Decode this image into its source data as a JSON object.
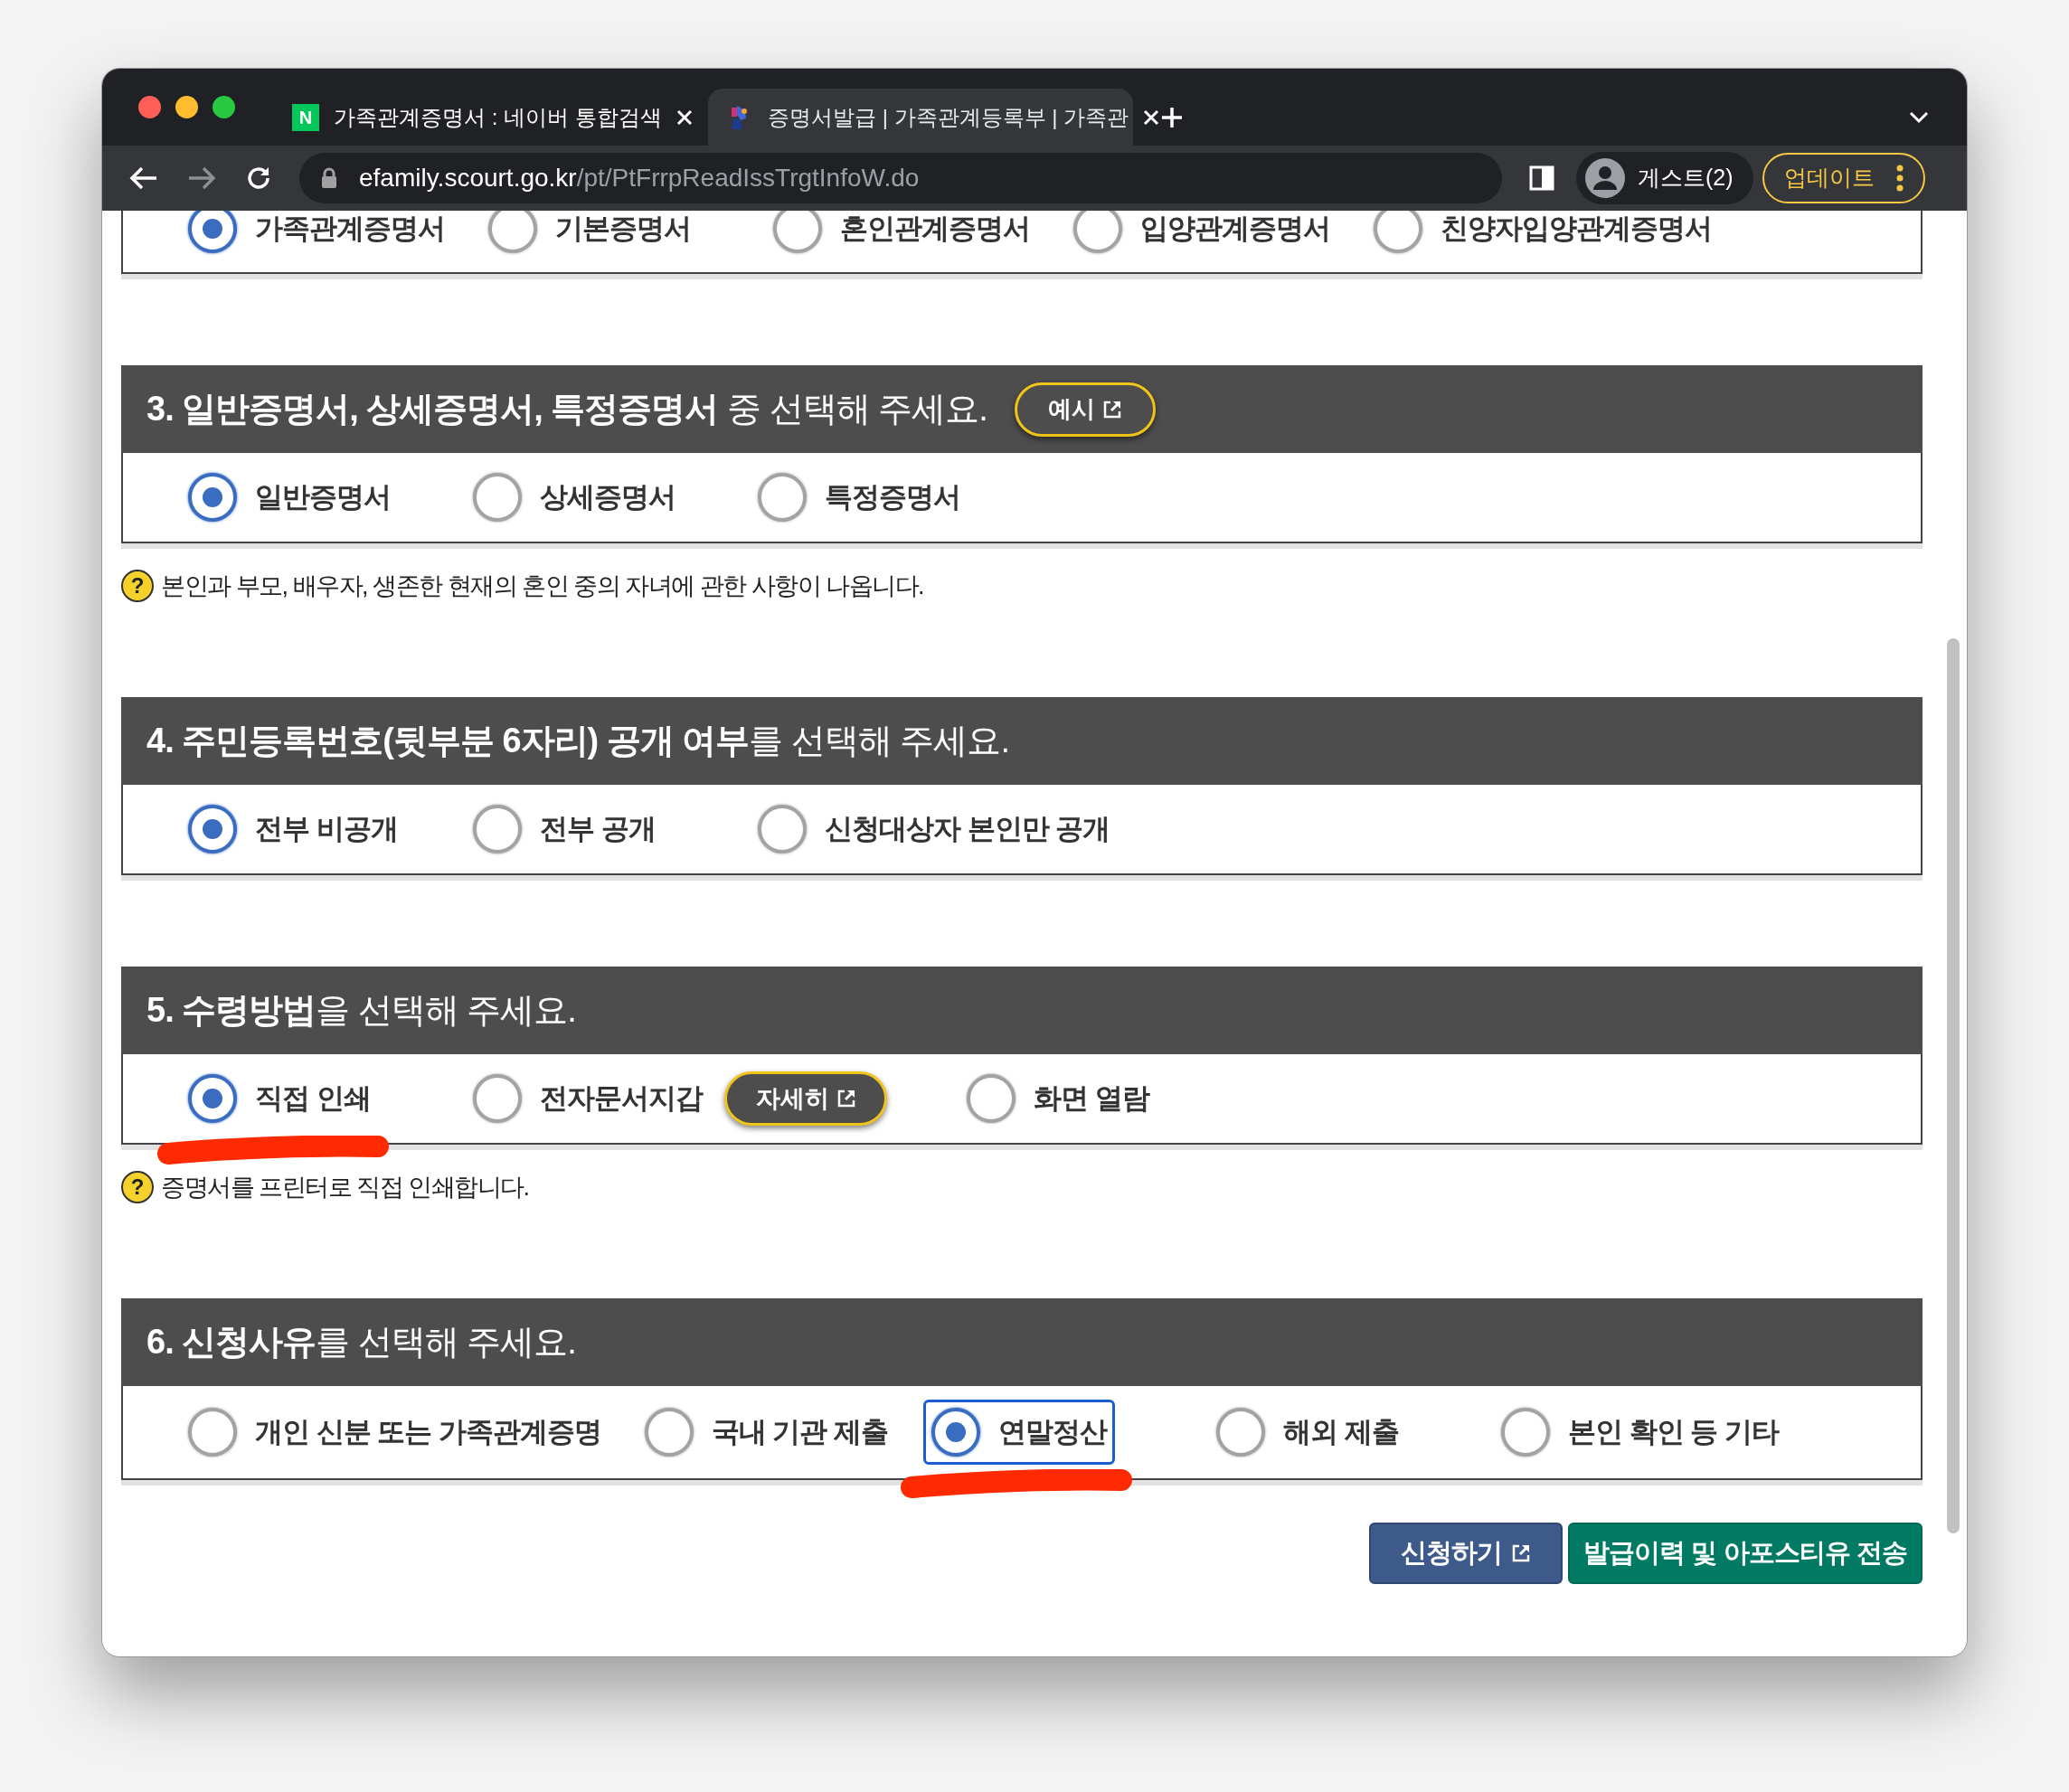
{
  "browser": {
    "tabs": [
      {
        "title": "가족관계증명서 : 네이버 통합검색",
        "favicon": "N",
        "selected": false
      },
      {
        "title": "증명서발급 | 가족관계등록부 | 가족관",
        "selected": true
      }
    ],
    "address": {
      "host": "efamily.scourt.go.kr",
      "path": "/pt/PtFrrpReadIssTrgtInfoW.do"
    },
    "profile": "게스트(2)",
    "update_button": "업데이트"
  },
  "sections": [
    {
      "options": [
        {
          "label": "가족관계증명서",
          "selected": true
        },
        {
          "label": "기본증명서",
          "selected": false
        },
        {
          "label": "혼인관계증명서",
          "selected": false
        },
        {
          "label": "입양관계증명서",
          "selected": false
        },
        {
          "label": "친양자입양관계증명서",
          "selected": false
        }
      ]
    },
    {
      "heading": "**3. 일반증명서, 상세증명서, 특정증명서** 중 선택해 주세요.",
      "heading_button": "예시",
      "options": [
        {
          "label": "일반증명서",
          "selected": true
        },
        {
          "label": "상세증명서",
          "selected": false
        },
        {
          "label": "특정증명서",
          "selected": false
        }
      ],
      "help": {
        "icon": "?",
        "text": "본인과 부모, 배우자, 생존한 현재의 혼인 중의 자녀에 관한 사항이 나옵니다."
      }
    },
    {
      "heading": "**4. 주민등록번호(뒷부분 6자리) 공개 여부**를 선택해 주세요.",
      "options": [
        {
          "label": "전부 비공개",
          "selected": true
        },
        {
          "label": "전부 공개",
          "selected": false
        },
        {
          "label": "신청대상자 본인만 공개",
          "selected": false
        }
      ]
    },
    {
      "heading": "**5. 수령방법**을 선택해 주세요.",
      "options": [
        {
          "label": "직접 인쇄",
          "selected": true,
          "marked": true
        },
        {
          "label": "전자문서지갑",
          "selected": false,
          "marked": false,
          "detail_button": "자세히"
        },
        {
          "label": "화면 열람",
          "selected": false,
          "marked": false
        }
      ],
      "help": {
        "icon": "?",
        "text": "증명서를 프린터로 직접 인쇄합니다."
      }
    },
    {
      "heading": "**6. 신청사유**를 선택해 주세요.",
      "options": [
        {
          "label": "개인 신분 또는 가족관계증명",
          "selected": false,
          "marked": false,
          "focused": false
        },
        {
          "label": "국내 기관 제출",
          "selected": false,
          "marked": false,
          "focused": false
        },
        {
          "label": "연말정산",
          "selected": true,
          "marked": true,
          "focused": true
        },
        {
          "label": "해외 제출",
          "selected": false,
          "marked": false,
          "focused": false
        },
        {
          "label": "본인 확인 등 기타",
          "selected": false,
          "marked": false,
          "focused": false
        }
      ]
    }
  ],
  "buttons": [
    {
      "label": "신청하기",
      "kind": "primary",
      "external": true
    },
    {
      "label": "발급이력 및 아포스티유 전송",
      "kind": "send",
      "external": false
    }
  ]
}
